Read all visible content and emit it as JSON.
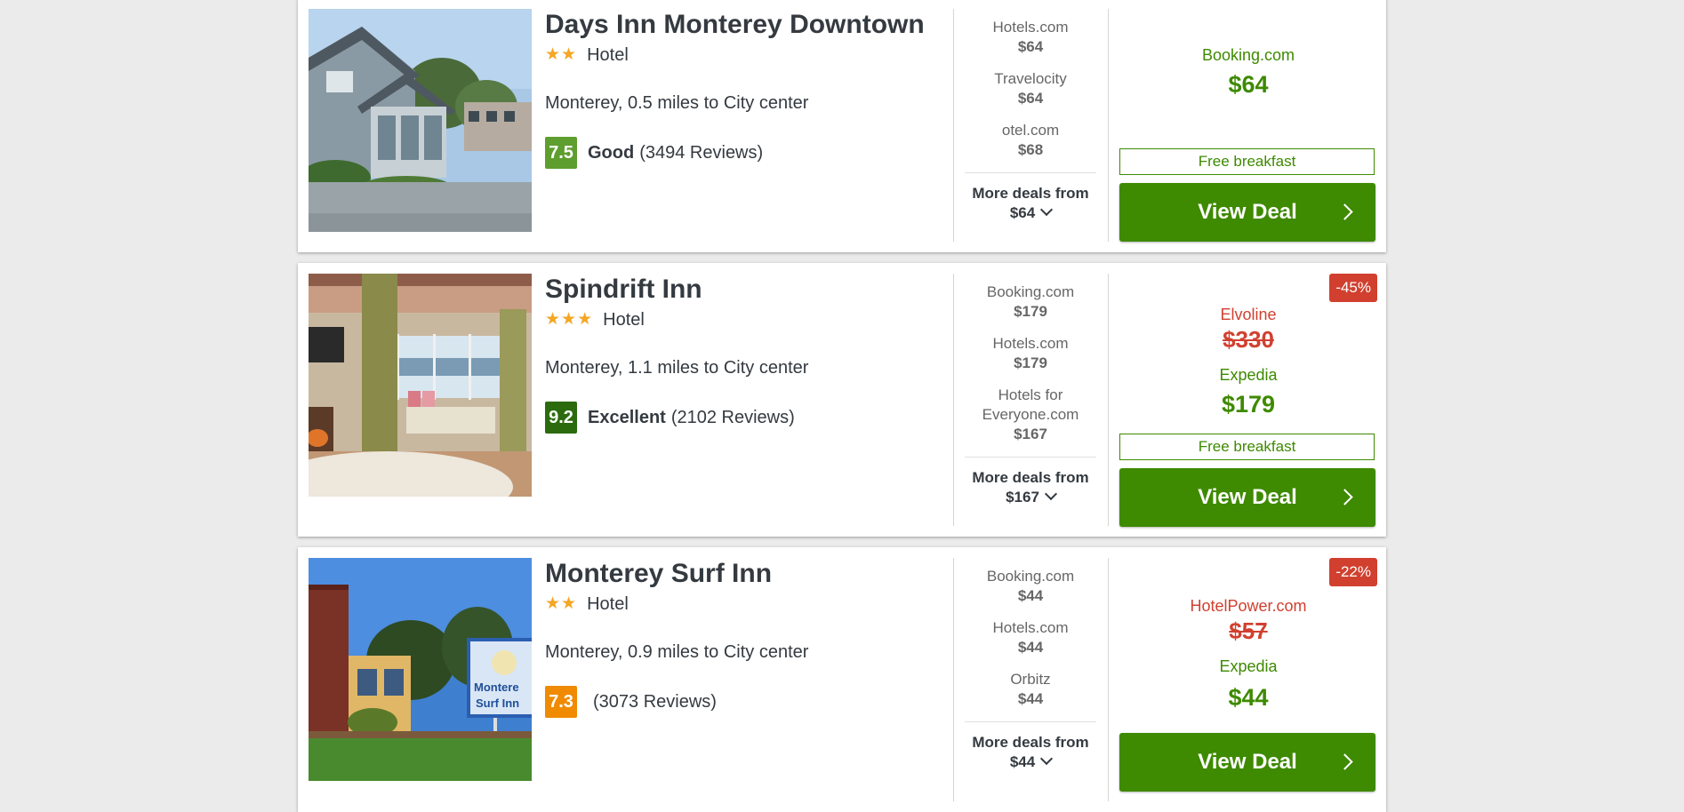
{
  "hotels": [
    {
      "name": "Days Inn Monterey Downtown",
      "stars": 2,
      "type": "Hotel",
      "location": "Monterey, 0.5 miles to City center",
      "score": "7.5",
      "score_color": "#5e9e2e",
      "rating_word": "Good",
      "reviews": "(3494 Reviews)",
      "deals": [
        {
          "site": "Hotels.com",
          "price": "$64"
        },
        {
          "site": "Travelocity",
          "price": "$64"
        },
        {
          "site": "otel.com",
          "price": "$68"
        }
      ],
      "more_label": "More deals from",
      "more_price": "$64",
      "badge": "",
      "provider": "Booking.com",
      "old_provider": "",
      "old_price": "",
      "price": "$64",
      "perk": "Free breakfast",
      "button": "View Deal"
    },
    {
      "name": "Spindrift Inn",
      "stars": 3,
      "type": "Hotel",
      "location": "Monterey, 1.1 miles to City center",
      "score": "9.2",
      "score_color": "#2b6b0e",
      "rating_word": "Excellent",
      "reviews": "(2102 Reviews)",
      "deals": [
        {
          "site": "Booking.com",
          "price": "$179"
        },
        {
          "site": "Hotels.com",
          "price": "$179"
        },
        {
          "site": "Hotels for Everyone.com",
          "price": "$167"
        }
      ],
      "more_label": "More deals from",
      "more_price": "$167",
      "badge": "-45%",
      "old_provider": "Elvoline",
      "old_price": "$330",
      "provider": "Expedia",
      "price": "$179",
      "perk": "Free breakfast",
      "button": "View Deal"
    },
    {
      "name": "Monterey Surf Inn",
      "stars": 2,
      "type": "Hotel",
      "location": "Monterey, 0.9 miles to City center",
      "score": "7.3",
      "score_color": "#f08a00",
      "rating_word": "",
      "reviews": "(3073 Reviews)",
      "deals": [
        {
          "site": "Booking.com",
          "price": "$44"
        },
        {
          "site": "Hotels.com",
          "price": "$44"
        },
        {
          "site": "Orbitz",
          "price": "$44"
        }
      ],
      "more_label": "More deals from",
      "more_price": "$44",
      "badge": "-22%",
      "old_provider": "HotelPower.com",
      "old_price": "$57",
      "provider": "Expedia",
      "price": "$44",
      "perk": "",
      "button": "View Deal"
    }
  ],
  "photo_sign": [
    "Montere",
    "Surf Inn"
  ]
}
